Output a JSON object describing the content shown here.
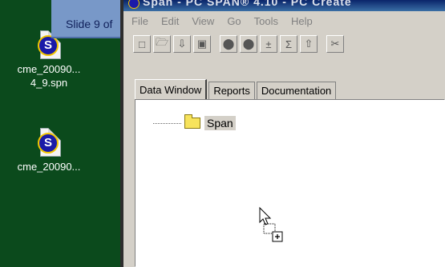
{
  "desktop": {
    "icons": [
      {
        "label_line1": "cme_20090...",
        "label_line2": "4_9.spn"
      },
      {
        "label_line1": "cme_20090...",
        "label_line2": ""
      }
    ]
  },
  "taskbar": {
    "slide_label": "Slide 9 of"
  },
  "window": {
    "title": "Span - PC SPAN® 4.10 - PC Create",
    "menu": [
      "File",
      "Edit",
      "View",
      "Go",
      "Tools",
      "Help"
    ],
    "toolbar_icons": [
      "new-icon",
      "open-icon",
      "import-icon",
      "save-icon",
      "stop-icon",
      "stop2-icon",
      "plusminus-icon",
      "sigma-icon",
      "upload-icon",
      "cut-icon"
    ],
    "tabs": [
      "Data Window",
      "Reports",
      "Documentation"
    ],
    "active_tab": "Data Window",
    "tree": {
      "root_label": "Span"
    }
  }
}
